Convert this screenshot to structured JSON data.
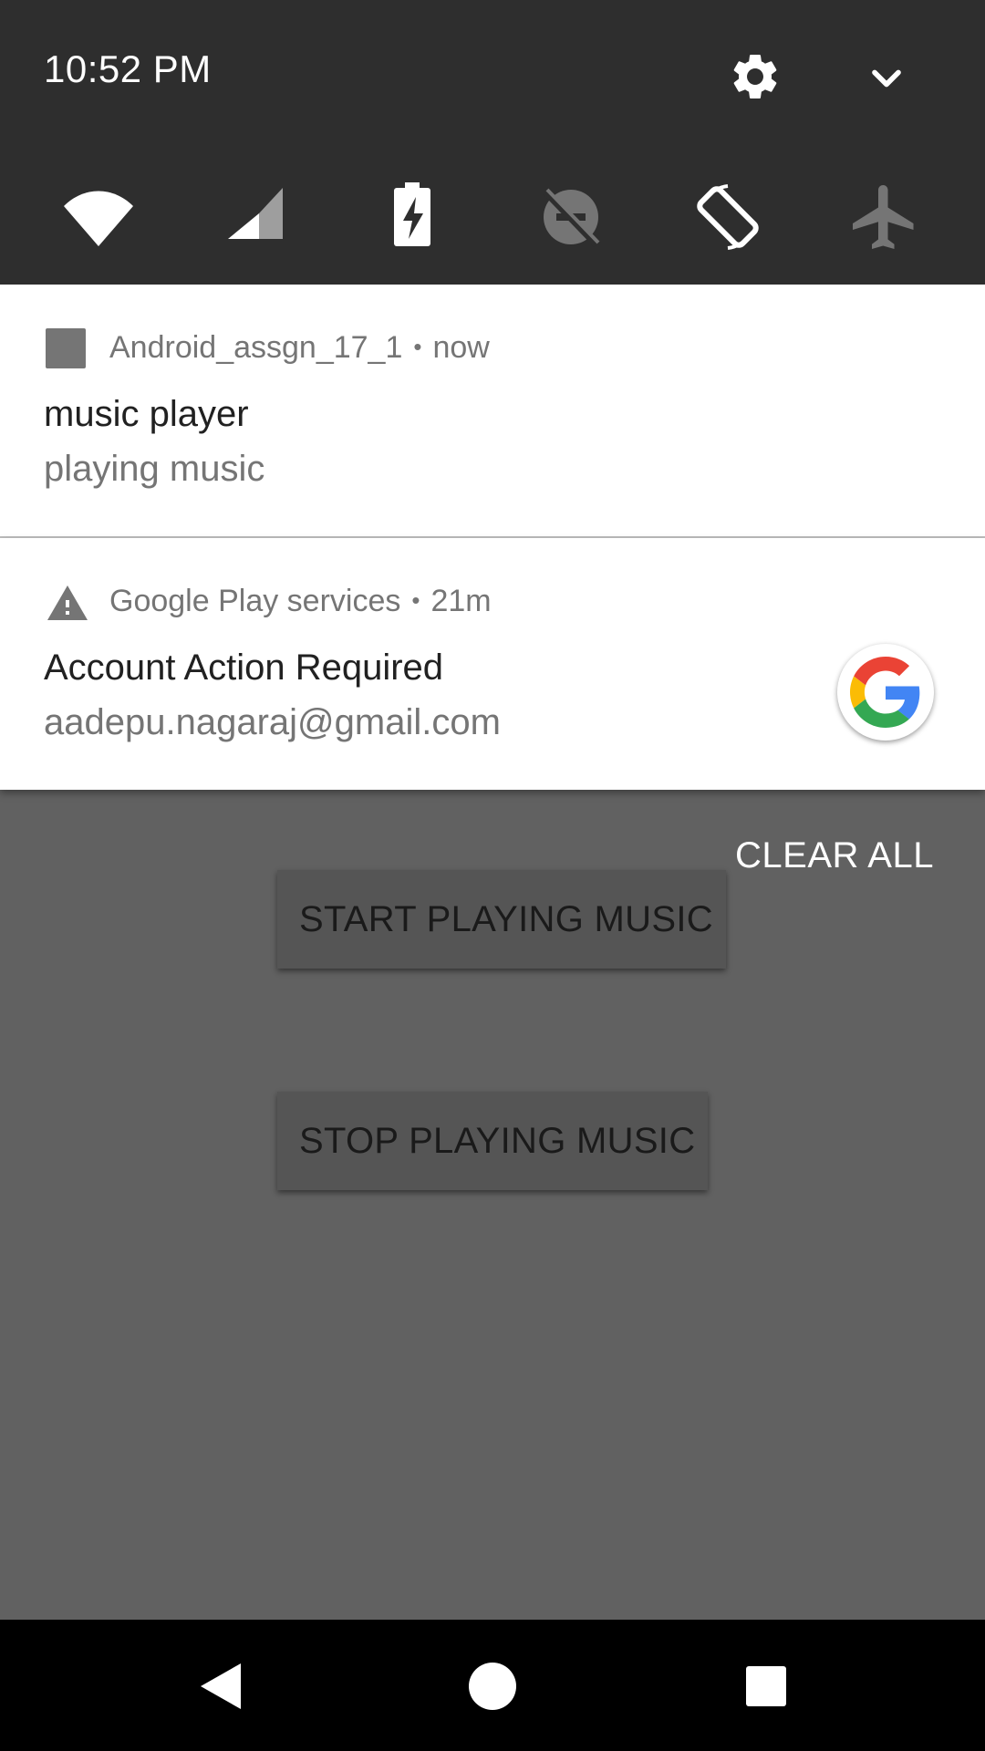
{
  "status": {
    "time": "10:52 PM",
    "settings_icon": "gear-icon",
    "expand_icon": "chevron-down-icon"
  },
  "quick_tiles": [
    {
      "name": "wifi-icon"
    },
    {
      "name": "cellular-signal-icon"
    },
    {
      "name": "battery-charging-icon"
    },
    {
      "name": "do-not-disturb-off-icon"
    },
    {
      "name": "auto-rotate-icon"
    },
    {
      "name": "airplane-mode-off-icon"
    }
  ],
  "notifications": [
    {
      "app": "Android_assgn_17_1",
      "separator": "•",
      "time": "now",
      "title": "music player",
      "text": "playing music",
      "icon": "app-square-icon"
    },
    {
      "app": "Google Play services",
      "separator": "•",
      "time": "21m",
      "title": "Account Action Required",
      "text": "aadepu.nagaraj@gmail.com",
      "icon": "warning-icon",
      "large_icon": "google-g-icon"
    }
  ],
  "clear_all": "CLEAR ALL",
  "app": {
    "start_button": "START PLAYING MUSIC",
    "stop_button": "STOP PLAYING MUSIC"
  },
  "colors": {
    "shade_bg": "#2e2e2e",
    "scrim_bg": "#616161",
    "google_blue": "#4285F4",
    "google_red": "#EA4335",
    "google_yellow": "#FBBC05",
    "google_green": "#34A853"
  }
}
